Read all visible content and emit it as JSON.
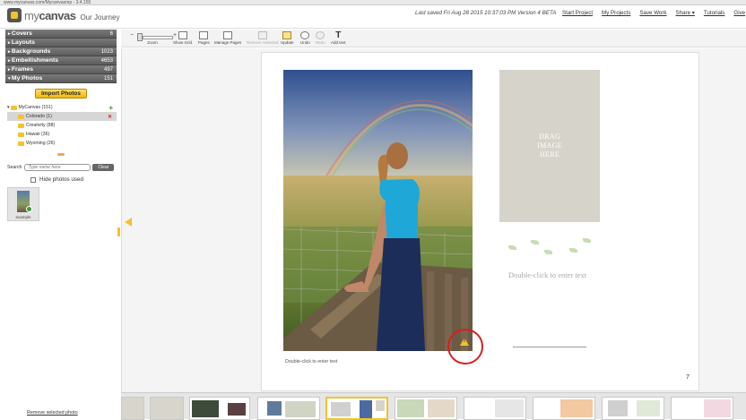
{
  "browser": {
    "url": "www.mycanvas.com/Mycanvasmp - 3.4.155"
  },
  "app": {
    "logo_prefix": "my",
    "logo_name": "canvas",
    "project_name": "Our Journey"
  },
  "header": {
    "last_saved": "Last saved Fri Aug 28 2015 10:37:03 PM Version 4 BETA",
    "links": [
      "Start Project",
      "My Projects",
      "Save Work",
      "Share ▾",
      "Tutorials",
      "Give"
    ]
  },
  "toolbar": {
    "zoom": "Zoom",
    "show_grid": "Show Grid",
    "pages": "Pages",
    "manage_pages": "Manage Pages",
    "disabled_tool": "Remove Selected",
    "update": "Update",
    "undo": "Undo",
    "redo": "Redo",
    "add_text": "Add text"
  },
  "sidebar": {
    "sections": [
      {
        "name": "Covers",
        "count": "6"
      },
      {
        "name": "Layouts",
        "count": ""
      },
      {
        "name": "Backgrounds",
        "count": "1023"
      },
      {
        "name": "Embellishments",
        "count": "4653"
      },
      {
        "name": "Frames",
        "count": "497"
      },
      {
        "name": "My Photos",
        "count": "151"
      }
    ],
    "import_button": "Import Photos",
    "tree": {
      "root": "MyCanvas (151)",
      "folders": [
        "Colorado (1)",
        "Creativity (88)",
        "Hawaii (36)",
        "Wyoming (26)"
      ]
    },
    "search_label": "Search",
    "search_placeholder": "Type name here",
    "clear_button": "Clear",
    "hide_used": "Hide photos used",
    "photo_label": "example",
    "remove_link": "Remove selected photo"
  },
  "page": {
    "photo_caption": "Double-click to enter text",
    "drag_box": "DRAG\nIMAGE\nHERE",
    "text_placeholder": "Double-click to enter text",
    "page_number": "7"
  },
  "colors": {
    "accent": "#f2c230",
    "warning_circle": "#d81f1f",
    "sidebar_header": "#666666"
  }
}
